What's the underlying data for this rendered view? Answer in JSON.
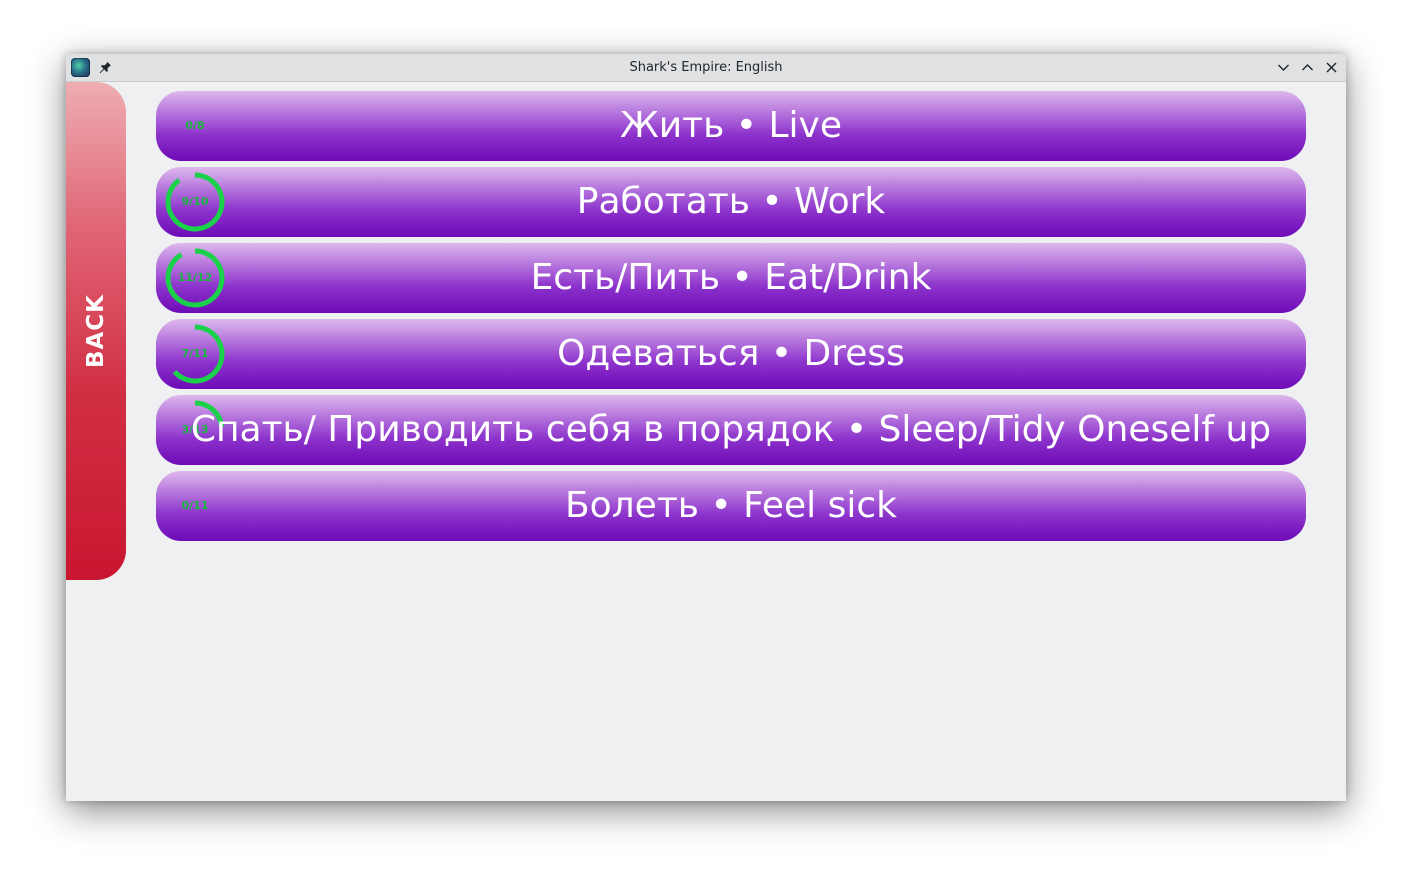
{
  "window": {
    "title": "Shark's Empire: English",
    "icons": {
      "app": "app-icon",
      "pin": "pin-icon",
      "minimize": "chevron-down-icon",
      "maximize": "chevron-up-icon",
      "close": "close-icon"
    }
  },
  "back_button": {
    "label": "BACK"
  },
  "topics": [
    {
      "label": "Жить • Live",
      "progress": "0/8",
      "done": 0,
      "total": 8
    },
    {
      "label": "Работать • Work",
      "progress": "9/10",
      "done": 9,
      "total": 10
    },
    {
      "label": "Есть/Пить • Eat/Drink",
      "progress": "11/12",
      "done": 11,
      "total": 12
    },
    {
      "label": "Одеваться • Dress",
      "progress": "7/11",
      "done": 7,
      "total": 11
    },
    {
      "label": "Спать/ Приводить себя в порядок • Sleep/Tidy Oneself up",
      "progress": "3/13",
      "done": 3,
      "total": 13
    },
    {
      "label": "Болеть • Feel sick",
      "progress": "0/11",
      "done": 0,
      "total": 11
    }
  ],
  "colors": {
    "progress_ring": "#19d24a",
    "progress_text": "#18b83e",
    "topic_button": "#8d33cc",
    "back_button": "#d12f44",
    "window_bg": "#eff0f1"
  }
}
